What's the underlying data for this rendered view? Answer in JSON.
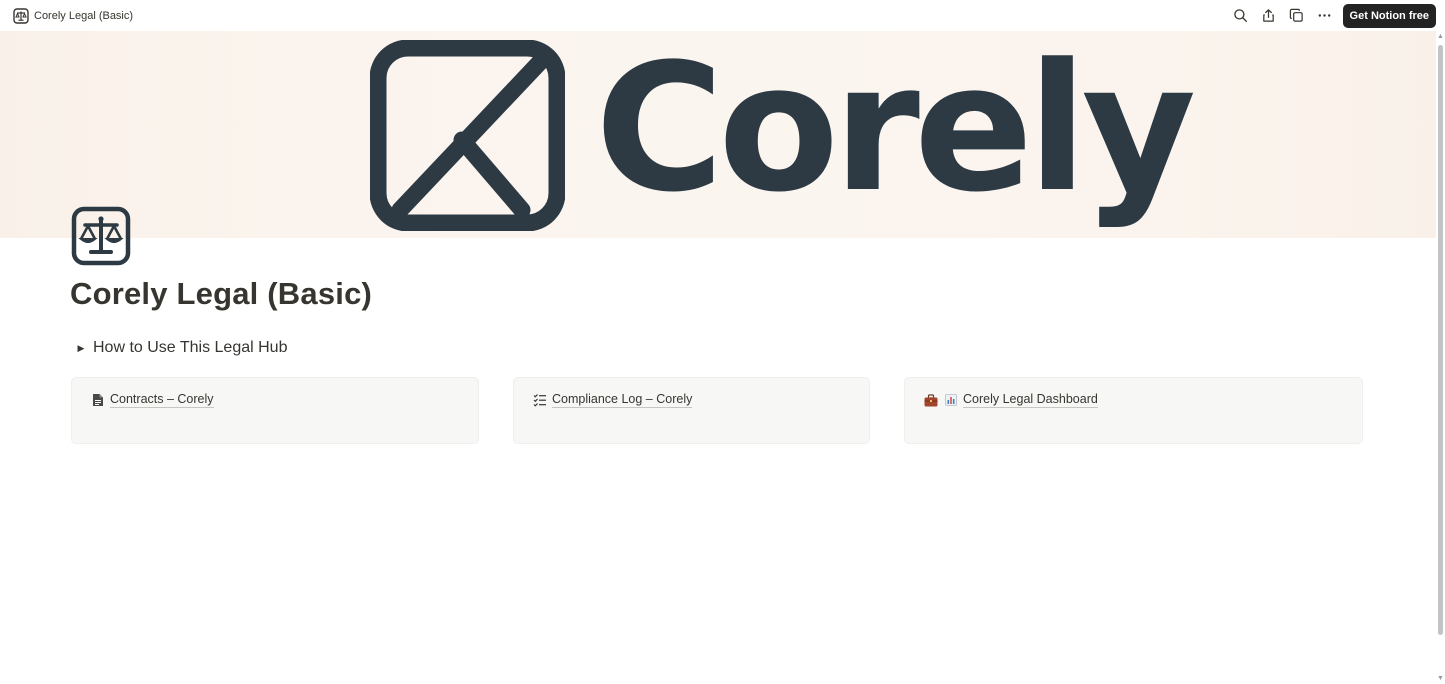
{
  "topbar": {
    "title": "Corely Legal (Basic)",
    "page_icon": "scales-icon",
    "actions": [
      {
        "name": "search",
        "icon": "search-icon"
      },
      {
        "name": "share",
        "icon": "share-icon"
      },
      {
        "name": "duplicate",
        "icon": "duplicate-icon"
      },
      {
        "name": "more",
        "icon": "more-icon"
      }
    ],
    "cta_label": "Get Notion free"
  },
  "cover": {
    "brand_text": "Corely",
    "logo_icon": "corely-logo-icon"
  },
  "page": {
    "title": "Corely Legal (Basic)",
    "icon": "scales-icon"
  },
  "toggle": {
    "label": "How to Use This Legal Hub",
    "expanded": false
  },
  "cards": [
    {
      "label": "Contracts – Corely",
      "icon": "document-icon"
    },
    {
      "label": "Compliance Log – Corely",
      "icon": "checklist-icon"
    },
    {
      "label": "Corely Legal Dashboard",
      "icon": "briefcase-icon",
      "secondary_icon": "bar-chart-icon"
    }
  ],
  "colors": {
    "text": "#37352f",
    "cta_bg": "#232323",
    "brand": "#2d3a43",
    "card_bg": "#f7f7f5",
    "cover_bg": "#fbf5f0"
  }
}
